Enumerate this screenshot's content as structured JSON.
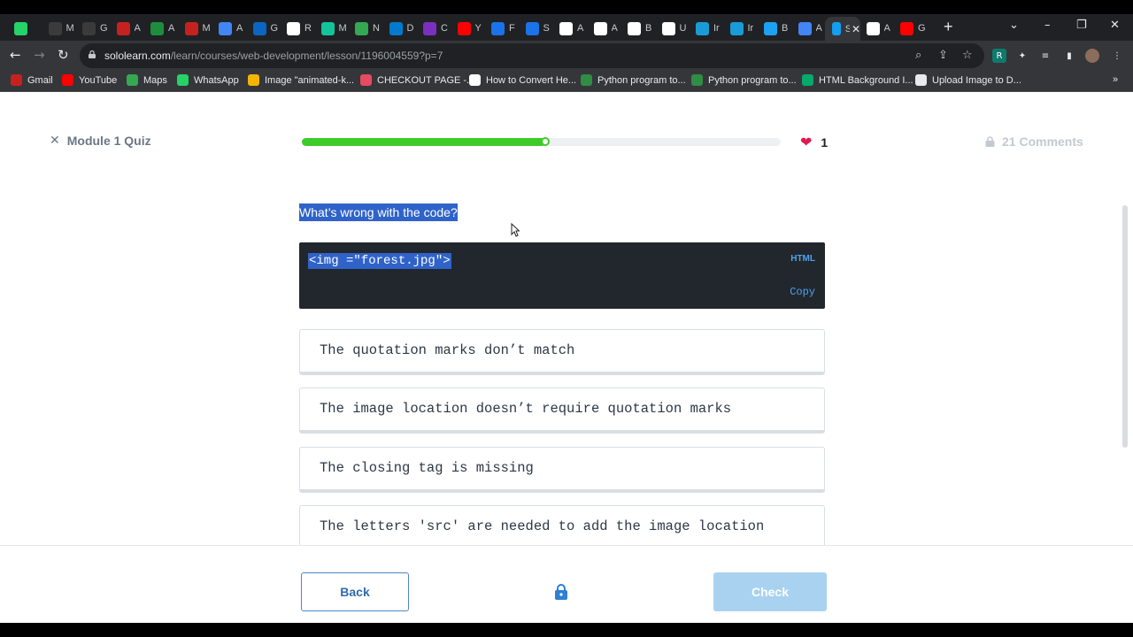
{
  "browser": {
    "tabs": [
      {
        "title": "",
        "icon": "whatsapp-icon",
        "color": "#25d366"
      },
      {
        "title": "M",
        "icon": "tab-icon",
        "color": "#3b3b3b"
      },
      {
        "title": "G",
        "icon": "github-icon",
        "color": "#3b3b3b"
      },
      {
        "title": "A",
        "icon": "gmail-icon",
        "color": "#c5221f"
      },
      {
        "title": "A",
        "icon": "drive-icon",
        "color": "#1e8e3e"
      },
      {
        "title": "M",
        "icon": "gmail-icon",
        "color": "#c5221f"
      },
      {
        "title": "A",
        "icon": "c-icon",
        "color": "#4285f4"
      },
      {
        "title": "G",
        "icon": "linkedin-icon",
        "color": "#0a66c2"
      },
      {
        "title": "R",
        "icon": "notion-icon",
        "color": "#ffffff"
      },
      {
        "title": "M",
        "icon": "grammarly-icon",
        "color": "#15c39a"
      },
      {
        "title": "N",
        "icon": "tab-icon",
        "color": "#34a853"
      },
      {
        "title": "D",
        "icon": "vscode-icon",
        "color": "#007acc"
      },
      {
        "title": "C",
        "icon": "tab-icon",
        "color": "#7b2fbe"
      },
      {
        "title": "Y",
        "icon": "youtube-icon",
        "color": "#ff0000"
      },
      {
        "title": "F",
        "icon": "c-icon",
        "color": "#1a73e8"
      },
      {
        "title": "S",
        "icon": "c-icon",
        "color": "#1a73e8"
      },
      {
        "title": "A",
        "icon": "amazon-icon",
        "color": "#ffffff"
      },
      {
        "title": "A",
        "icon": "amazon-icon",
        "color": "#ffffff"
      },
      {
        "title": "B",
        "icon": "amazon-icon",
        "color": "#ffffff"
      },
      {
        "title": "U",
        "icon": "globe-icon",
        "color": "#ffffff"
      },
      {
        "title": "Ir",
        "icon": "ist-icon",
        "color": "#1a9bd7"
      },
      {
        "title": "Ir",
        "icon": "ist-icon",
        "color": "#1a9bd7"
      },
      {
        "title": "B",
        "icon": "bird-icon",
        "color": "#1da1f2"
      },
      {
        "title": "A",
        "icon": "send-icon",
        "color": "#4285f4"
      },
      {
        "title": "Sc",
        "icon": "sololearn-icon",
        "color": "#149ef2"
      },
      {
        "title": "A",
        "icon": "tab-icon",
        "color": "#ffffff"
      },
      {
        "title": "G",
        "icon": "youtube-icon",
        "color": "#ff0000"
      }
    ],
    "url_host": "sololearn.com",
    "url_path": "/learn/courses/web-development/lesson/1196004559?p=7",
    "bookmarks": [
      {
        "label": "Gmail",
        "icon": "gmail-icon",
        "color": "#c5221f"
      },
      {
        "label": "YouTube",
        "icon": "youtube-icon",
        "color": "#ff0000"
      },
      {
        "label": "Maps",
        "icon": "maps-icon",
        "color": "#34a853"
      },
      {
        "label": "WhatsApp",
        "icon": "whatsapp-icon",
        "color": "#25d366"
      },
      {
        "label": "Image \"animated-k...",
        "icon": "star-icon",
        "color": "#f4b400"
      },
      {
        "label": "CHECKOUT PAGE -...",
        "icon": "lips-icon",
        "color": "#e84a5f"
      },
      {
        "label": "How to Convert He...",
        "icon": "alpha-icon",
        "color": "#ffffff"
      },
      {
        "label": "Python program to...",
        "icon": "gfg-icon",
        "color": "#2f8d46"
      },
      {
        "label": "Python program to...",
        "icon": "gfg-icon",
        "color": "#2f8d46"
      },
      {
        "label": "HTML Background I...",
        "icon": "w3-icon",
        "color": "#04aa6d"
      },
      {
        "label": "Upload Image to D...",
        "icon": "globe-icon",
        "color": "#e8eaed"
      }
    ],
    "more_bookmarks": "»"
  },
  "quiz": {
    "close_label": "Module 1 Quiz",
    "progress": 0.51,
    "lives": "1",
    "comments_label": "21 Comments",
    "question": "What’s wrong with the code?",
    "code": "<img =\"forest.jpg\">",
    "code_lang": "HTML",
    "copy_label": "Copy",
    "options": [
      "The quotation marks don’t match",
      "The image location doesn’t require quotation marks",
      "The closing tag is missing",
      "The letters 'src' are needed to add the image location"
    ],
    "back_label": "Back",
    "check_label": "Check"
  },
  "colors": {
    "progress": "#3ecb2a",
    "heart": "#e0174f",
    "check_disabled": "#a8d2f0",
    "selection": "#2f63c9"
  }
}
